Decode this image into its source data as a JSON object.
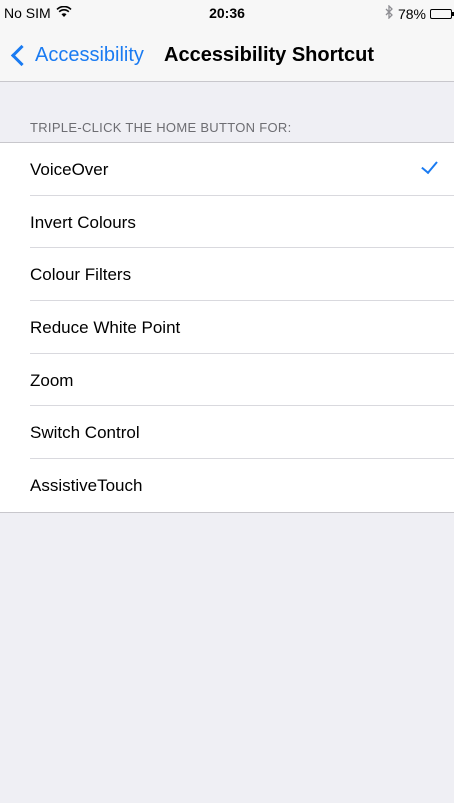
{
  "status_bar": {
    "carrier": "No SIM",
    "wifi_icon": "wifi-icon",
    "time": "20:36",
    "bluetooth_icon": "bluetooth-icon",
    "battery": "78%",
    "battery_level": 0.78
  },
  "nav": {
    "back_label": "Accessibility",
    "title": "Accessibility Shortcut"
  },
  "section": {
    "header": "TRIPLE-CLICK THE HOME BUTTON FOR:"
  },
  "options": [
    {
      "label": "VoiceOver",
      "selected": true
    },
    {
      "label": "Invert Colours",
      "selected": false
    },
    {
      "label": "Colour Filters",
      "selected": false
    },
    {
      "label": "Reduce White Point",
      "selected": false
    },
    {
      "label": "Zoom",
      "selected": false
    },
    {
      "label": "Switch Control",
      "selected": false
    },
    {
      "label": "AssistiveTouch",
      "selected": false
    }
  ],
  "colors": {
    "accent": "#1a7bf2",
    "background": "#efeff4"
  }
}
